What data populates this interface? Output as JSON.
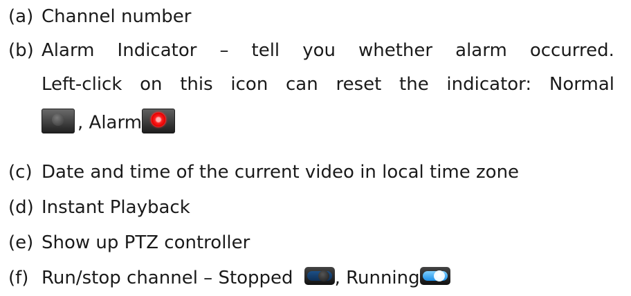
{
  "items": [
    {
      "marker": "(a)",
      "text": "Channel number"
    },
    {
      "marker": "(b)",
      "line1_words": [
        "Alarm",
        "Indicator",
        "–",
        "tell",
        "you",
        "whether",
        "alarm",
        "occurred."
      ],
      "line2_words": [
        "Left-click",
        "on",
        "this",
        "icon",
        "can",
        "reset",
        "the",
        "indicator:",
        "Normal"
      ],
      "line3_sep": ", Alarm",
      "icons": {
        "normal": "normal-indicator-icon",
        "alarm": "alarm-indicator-icon"
      }
    },
    {
      "marker": "(c)",
      "text": "Date and time of the current video in local time zone"
    },
    {
      "marker": "(d)",
      "text": "Instant Playback"
    },
    {
      "marker": "(e)",
      "text": "Show up PTZ controller"
    },
    {
      "marker": "(f)",
      "text": "Run/stop channel – Stopped",
      "sep": ", Running",
      "icons": {
        "stopped": "channel-stopped-icon",
        "running": "channel-running-icon"
      }
    }
  ],
  "colors": {
    "text": "#1a1a1a",
    "alarm_red": "#ff2020",
    "running_blue": "#1c8fe6",
    "stopped_blue": "#1d4f86"
  }
}
